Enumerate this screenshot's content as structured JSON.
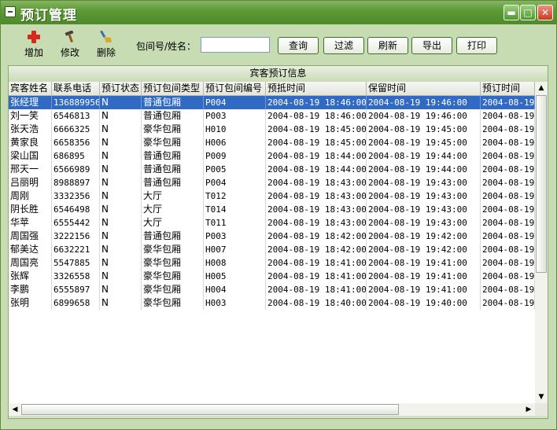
{
  "window": {
    "title": "预订管理"
  },
  "toolbar": {
    "add_label": "增加",
    "edit_label": "修改",
    "delete_label": "删除",
    "search_label": "包间号/姓名：",
    "search_value": "",
    "query_label": "查询",
    "filter_label": "过滤",
    "refresh_label": "刷新",
    "export_label": "导出",
    "print_label": "打印"
  },
  "grid": {
    "caption": "宾客预订信息",
    "columns": [
      "宾客姓名",
      "联系电话",
      "预订状态",
      "预订包间类型",
      "预订包间编号",
      "预抵时间",
      "保留时间",
      "预订时间"
    ],
    "rows": [
      [
        "张经理",
        "136889956",
        "N",
        "普通包厢",
        "P004",
        "2004-08-19 18:46:00",
        "2004-08-19 19:46:00",
        "2004-08-19"
      ],
      [
        "刘一笑",
        "6546813",
        "N",
        "普通包厢",
        "P003",
        "2004-08-19 18:46:00",
        "2004-08-19 19:46:00",
        "2004-08-19"
      ],
      [
        "张天浩",
        "6666325",
        "N",
        "豪华包厢",
        "H010",
        "2004-08-19 18:45:00",
        "2004-08-19 19:45:00",
        "2004-08-19"
      ],
      [
        "黄家良",
        "6658356",
        "N",
        "豪华包厢",
        "H006",
        "2004-08-19 18:45:00",
        "2004-08-19 19:45:00",
        "2004-08-19"
      ],
      [
        "梁山国",
        "686895",
        "N",
        "普通包厢",
        "P009",
        "2004-08-19 18:44:00",
        "2004-08-19 19:44:00",
        "2004-08-19"
      ],
      [
        "邢天一",
        "6566989",
        "N",
        "普通包厢",
        "P005",
        "2004-08-19 18:44:00",
        "2004-08-19 19:44:00",
        "2004-08-19"
      ],
      [
        "吕丽明",
        "8988897",
        "N",
        "普通包厢",
        "P004",
        "2004-08-19 18:43:00",
        "2004-08-19 19:43:00",
        "2004-08-19"
      ],
      [
        "周刚",
        "3332356",
        "N",
        "大厅",
        "T012",
        "2004-08-19 18:43:00",
        "2004-08-19 19:43:00",
        "2004-08-19"
      ],
      [
        "阴长胜",
        "6546498",
        "N",
        "大厅",
        "T014",
        "2004-08-19 18:43:00",
        "2004-08-19 19:43:00",
        "2004-08-19"
      ],
      [
        "华苹",
        "6555442",
        "N",
        "大厅",
        "T011",
        "2004-08-19 18:43:00",
        "2004-08-19 19:43:00",
        "2004-08-19"
      ],
      [
        "周国强",
        "3222156",
        "N",
        "普通包厢",
        "P003",
        "2004-08-19 18:42:00",
        "2004-08-19 19:42:00",
        "2004-08-19"
      ],
      [
        "郁美达",
        "6632221",
        "N",
        "豪华包厢",
        "H007",
        "2004-08-19 18:42:00",
        "2004-08-19 19:42:00",
        "2004-08-19"
      ],
      [
        "周国亮",
        "5547885",
        "N",
        "豪华包厢",
        "H008",
        "2004-08-19 18:41:00",
        "2004-08-19 19:41:00",
        "2004-08-19"
      ],
      [
        "张辉",
        "3326558",
        "N",
        "豪华包厢",
        "H005",
        "2004-08-19 18:41:00",
        "2004-08-19 19:41:00",
        "2004-08-19"
      ],
      [
        "李鹏",
        "6555897",
        "N",
        "豪华包厢",
        "H004",
        "2004-08-19 18:41:00",
        "2004-08-19 19:41:00",
        "2004-08-19"
      ],
      [
        "张明",
        "6899658",
        "N",
        "豪华包厢",
        "H003",
        "2004-08-19 18:40:00",
        "2004-08-19 19:40:00",
        "2004-08-19"
      ]
    ]
  },
  "colors": {
    "title_bar": "#5f9a36",
    "selection": "#316ac5",
    "window_bg": "#c8dcb4"
  },
  "icons": {
    "add": "plus-icon",
    "edit": "hammer-icon",
    "delete": "broom-icon"
  }
}
